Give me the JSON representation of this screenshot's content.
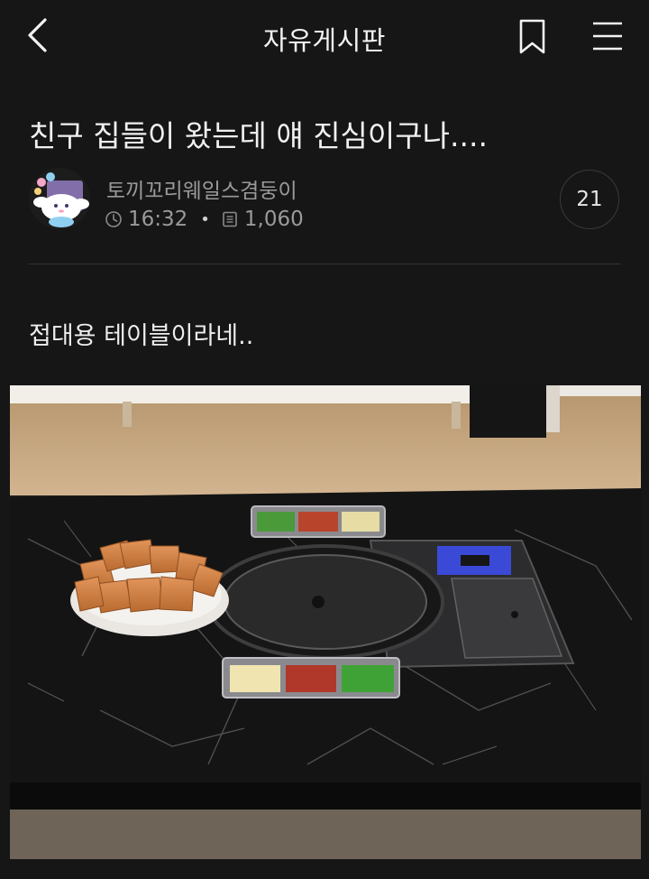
{
  "header": {
    "title": "자유게시판",
    "back_icon": "chevron-left-icon",
    "bookmark_icon": "bookmark-icon",
    "menu_icon": "hamburger-menu-icon"
  },
  "post": {
    "title": "친구 집들이 왔는데 얘 진심이구나....",
    "author": "토끼꼬리웨일스겸둥이",
    "time": "16:32",
    "views": "1,060",
    "comment_count": "21",
    "body": "접대용 테이블이라네.."
  },
  "colors": {
    "background": "#161616",
    "text_primary": "#f0f0f0",
    "text_secondary": "#9a9a9a",
    "divider": "#333333"
  }
}
